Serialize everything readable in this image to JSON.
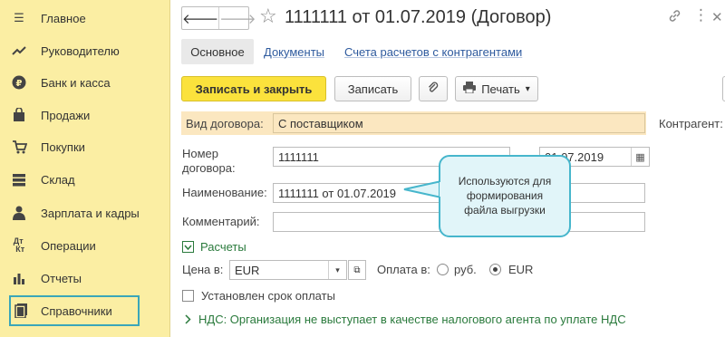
{
  "sidebar": {
    "items": [
      {
        "label": "Главное",
        "icon": "menu-icon"
      },
      {
        "label": "Руководителю",
        "icon": "trend-icon"
      },
      {
        "label": "Банк и касса",
        "icon": "ruble-icon"
      },
      {
        "label": "Продажи",
        "icon": "shopping-bag-icon"
      },
      {
        "label": "Покупки",
        "icon": "cart-icon"
      },
      {
        "label": "Склад",
        "icon": "warehouse-icon"
      },
      {
        "label": "Зарплата и кадры",
        "icon": "person-icon"
      },
      {
        "label": "Операции",
        "icon": "debit-credit-icon"
      },
      {
        "label": "Отчеты",
        "icon": "bar-chart-icon"
      },
      {
        "label": "Справочники",
        "icon": "book-icon"
      }
    ],
    "active_index": 9
  },
  "header": {
    "title": "1111111 от 01.07.2019 (Договор)",
    "back": "🡐",
    "forward": "🡒",
    "star": "☆",
    "link_icon": "🔗",
    "more_icon": "⋮",
    "close_icon": "✕"
  },
  "tabs": [
    "Основное",
    "Документы",
    "Счета расчетов с контрагентами"
  ],
  "toolbar": {
    "save_close": "Записать и закрыть",
    "save": "Записать",
    "attach_icon": "📎",
    "print_icon": "🖶",
    "print": "Печать",
    "dropdown_arrow": "▾"
  },
  "form": {
    "kind_label": "Вид договора:",
    "kind_value": "С поставщиком",
    "counterparty_label": "Контрагент:",
    "number_label_1": "Номер",
    "number_label_2": "договора:",
    "number_value": "1111111",
    "date_value": "01.07.2019",
    "name_label": "Наименование:",
    "name_value": "1111111 от 01.07.2019",
    "comment_label": "Комментарий:",
    "comment_value": ""
  },
  "callout": {
    "line1": "Используются для",
    "line2": "формирования",
    "line3": "файла выгрузки"
  },
  "settlements": {
    "title": "Расчеты",
    "price_label": "Цена в:",
    "price_value": "EUR",
    "payment_label": "Оплата в:",
    "option_rub": "руб.",
    "option_eur": "EUR",
    "selected": "EUR",
    "term_label": "Установлен срок оплаты"
  },
  "vat": {
    "text": "НДС: Организация не выступает в качестве налогового агента по уплате НДС"
  }
}
